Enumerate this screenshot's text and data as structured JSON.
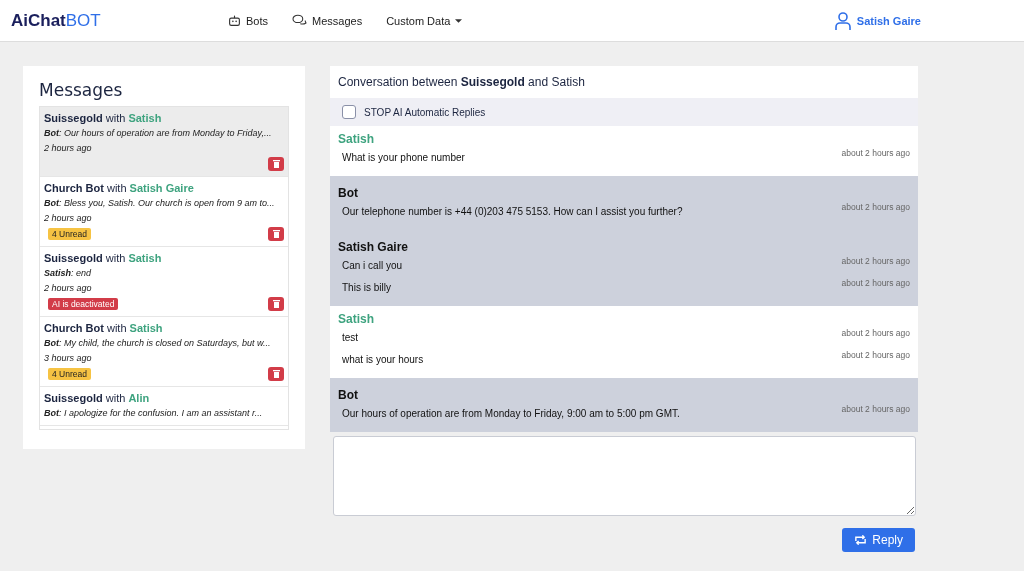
{
  "navbar": {
    "logo_main": "AiChat",
    "logo_accent": "BOT",
    "links": [
      {
        "label": "Bots"
      },
      {
        "label": "Messages"
      },
      {
        "label": "Custom Data"
      }
    ],
    "user": "Satish Gaire"
  },
  "messages_panel": {
    "title": "Messages",
    "items": [
      {
        "bot": "Suissegold",
        "with": "with",
        "user": "Satish",
        "preview": "**Bot**: Our hours of operation are from Monday to Friday,...",
        "time": "2 hours ago",
        "selected": true
      },
      {
        "bot": "Church Bot",
        "with": "with",
        "user": "Satish Gaire",
        "preview": "**Bot**: Bless you, Satish. Our church is open from 9 am to...",
        "time": "2 hours ago",
        "selected": false,
        "badge": {
          "kind": "unread",
          "label": "4 Unread"
        }
      },
      {
        "bot": "Suissegold",
        "with": "with",
        "user": "Satish",
        "preview": "**Satish**: end",
        "time": "2 hours ago",
        "selected": false,
        "badge": {
          "kind": "deactivated",
          "label": "AI is deactivated"
        }
      },
      {
        "bot": "Church Bot",
        "with": "with",
        "user": "Satish",
        "preview": "**Bot**: My child, the church is closed on Saturdays, but w...",
        "time": "3 hours ago",
        "selected": false,
        "badge": {
          "kind": "unread",
          "label": "4 Unread"
        }
      },
      {
        "bot": "Suissegold",
        "with": "with",
        "user": "Alin",
        "preview": "**Bot**: I apologize for the confusion. I am an assistant r...",
        "selected": false
      }
    ]
  },
  "conversation": {
    "title": "Conversation between **Suissegold** and Satish",
    "stop_ai": {
      "label": "STOP AI Automatic Replies",
      "checked": false
    },
    "groups": [
      {
        "kind": "user",
        "sender": "Satish",
        "messages": [
          {
            "text": "What is your phone number",
            "time": "about 2 hours ago"
          }
        ]
      },
      {
        "kind": "bot",
        "sender": "Bot",
        "messages": [
          {
            "text": "Our telephone number is +44 (0)203 475 5153. How can I assist you further?",
            "time": "about 2 hours ago"
          }
        ]
      },
      {
        "kind": "agent",
        "sender": "Satish Gaire",
        "messages": [
          {
            "text": "Can i call you",
            "time": "about 2 hours ago"
          },
          {
            "text": "This is billy",
            "time": "about 2 hours ago"
          }
        ]
      },
      {
        "kind": "user",
        "sender": "Satish",
        "messages": [
          {
            "text": "test",
            "time": "about 2 hours ago"
          },
          {
            "text": "what is your hours",
            "time": "about 2 hours ago"
          }
        ]
      },
      {
        "kind": "bot",
        "sender": "Bot",
        "messages": [
          {
            "text": "Our hours of operation are from Monday to Friday, 9:00 am to 5:00 pm GMT.",
            "time": "about 2 hours ago"
          }
        ]
      }
    ],
    "reply_button": "Reply"
  }
}
